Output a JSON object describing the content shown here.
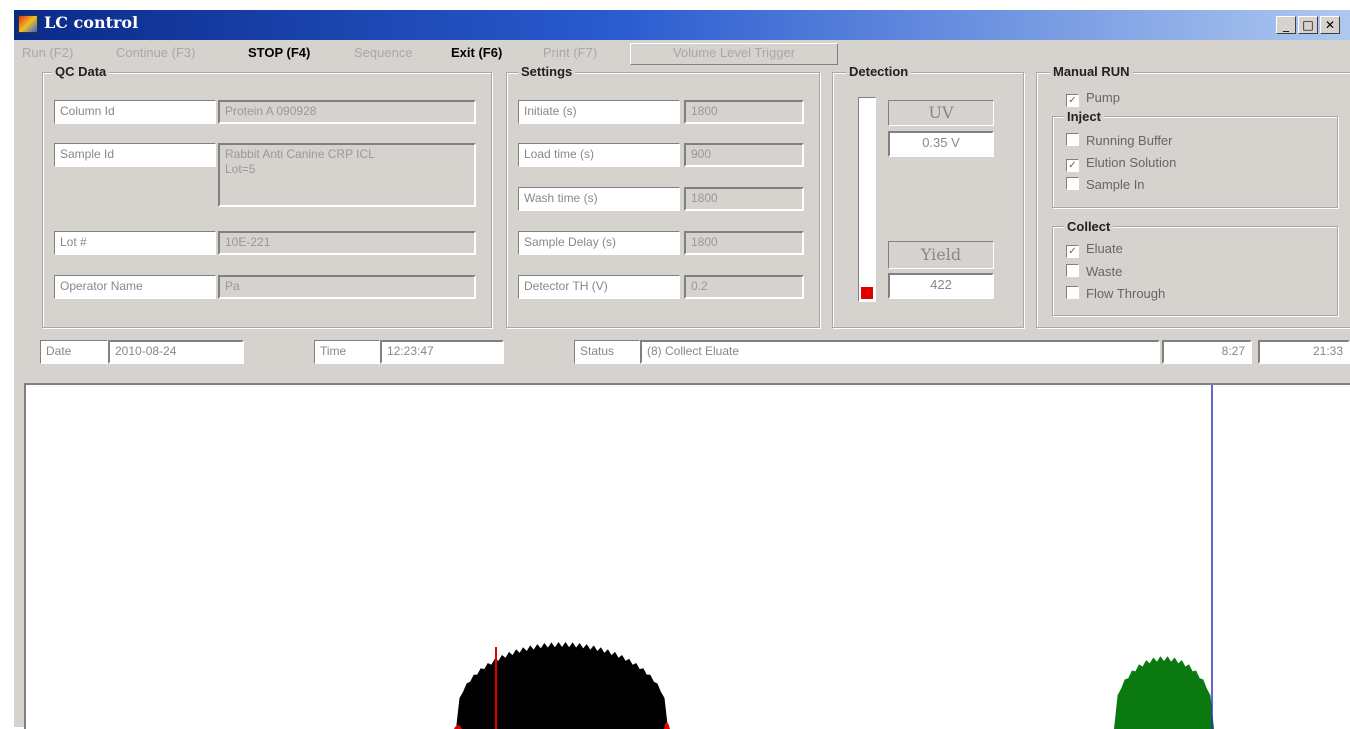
{
  "window": {
    "title": "LC control"
  },
  "menu": {
    "run": "Run (F2)",
    "continue": "Continue (F3)",
    "stop": "STOP (F4)",
    "sequence": "Sequence",
    "exit": "Exit (F6)",
    "print": "Print (F7)",
    "volume_trigger": "Volume Level Trigger"
  },
  "qc": {
    "legend": "QC Data",
    "column_id_label": "Column Id",
    "column_id_value": "Protein A 090928",
    "sample_id_label": "Sample Id",
    "sample_id_value_line1": "Rabbit Anti Canine CRP ICL",
    "sample_id_value_line2": "Lot=5",
    "lot_label": "Lot #",
    "lot_value": "10E-221",
    "operator_label": "Operator Name",
    "operator_value": "Pa"
  },
  "settings": {
    "legend": "Settings",
    "initiate_label": "Initiate (s)",
    "initiate_value": "1800",
    "load_label": "Load time (s)",
    "load_value": "900",
    "wash_label": "Wash time (s)",
    "wash_value": "1800",
    "delay_label": "Sample Delay (s)",
    "delay_value": "1800",
    "detector_label": "Detector TH (V)",
    "detector_value": "0.2"
  },
  "detection": {
    "legend": "Detection",
    "uv_label": "UV",
    "uv_value": "0.35 V",
    "yield_label": "Yield",
    "yield_value": "422",
    "level_fraction": 0.06
  },
  "manual": {
    "legend": "Manual RUN",
    "pump": {
      "label": "Pump",
      "checked": true
    },
    "inject_legend": "Inject",
    "running_buffer": {
      "label": "Running Buffer",
      "checked": false
    },
    "elution_solution": {
      "label": "Elution Solution",
      "checked": true
    },
    "sample_in": {
      "label": "Sample In",
      "checked": false
    },
    "collect_legend": "Collect",
    "eluate": {
      "label": "Eluate",
      "checked": true
    },
    "waste": {
      "label": "Waste",
      "checked": false
    },
    "flow_through": {
      "label": "Flow Through",
      "checked": false
    }
  },
  "statusbar": {
    "date_label": "Date",
    "date_value": "2010-08-24",
    "time_label": "Time",
    "time_value": "12:23:47",
    "status_label": "Status",
    "status_value": "(8) Collect Eluate",
    "elapsed": "8:27",
    "remaining": "21:33"
  },
  "colors": {
    "peak1": "#000000",
    "peak2": "#0a7a10",
    "marker": "#e00000",
    "cursor": "#3030c0"
  }
}
